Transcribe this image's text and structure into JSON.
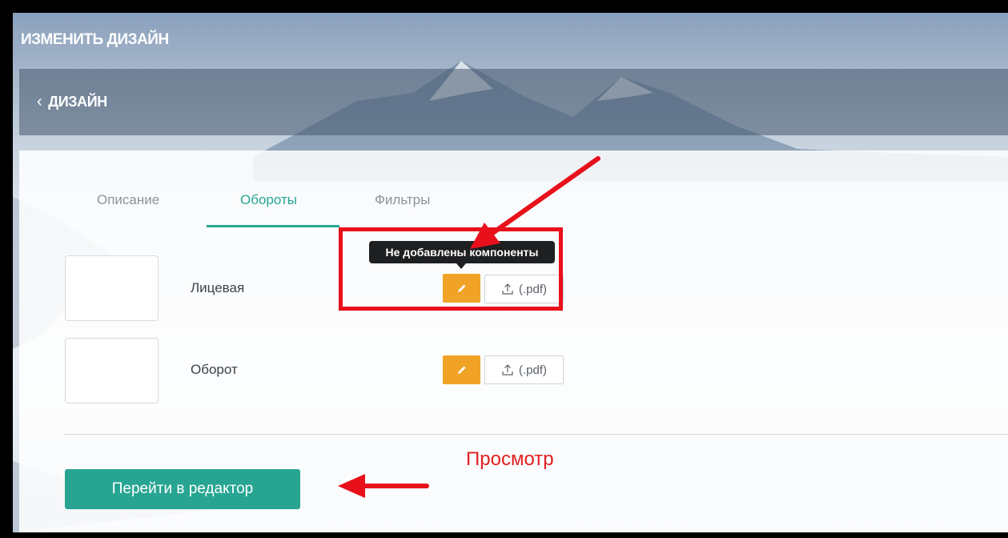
{
  "app": {
    "title": "ИЗМЕНИТЬ ДИЗАЙН"
  },
  "breadcrumb": {
    "back_label": "ДИЗАЙН",
    "back_icon": "chevron-left-icon"
  },
  "tabs": [
    {
      "label": "Описание",
      "active": false
    },
    {
      "label": "Обороты",
      "active": true
    },
    {
      "label": "Фильтры",
      "active": false
    }
  ],
  "sides": [
    {
      "label": "Лицевая",
      "upload_label": "(.pdf)"
    },
    {
      "label": "Оборот",
      "upload_label": "(.pdf)"
    }
  ],
  "tooltip": {
    "text": "Не добавлены компоненты"
  },
  "actions": {
    "editor_label": "Перейти в редактор"
  },
  "annotation": {
    "label": "Просмотр"
  },
  "colors": {
    "accent": "#27a592",
    "edit_button": "#f0a326",
    "annotation_red": "#e8101a",
    "tooltip_bg": "#1e1f21"
  }
}
